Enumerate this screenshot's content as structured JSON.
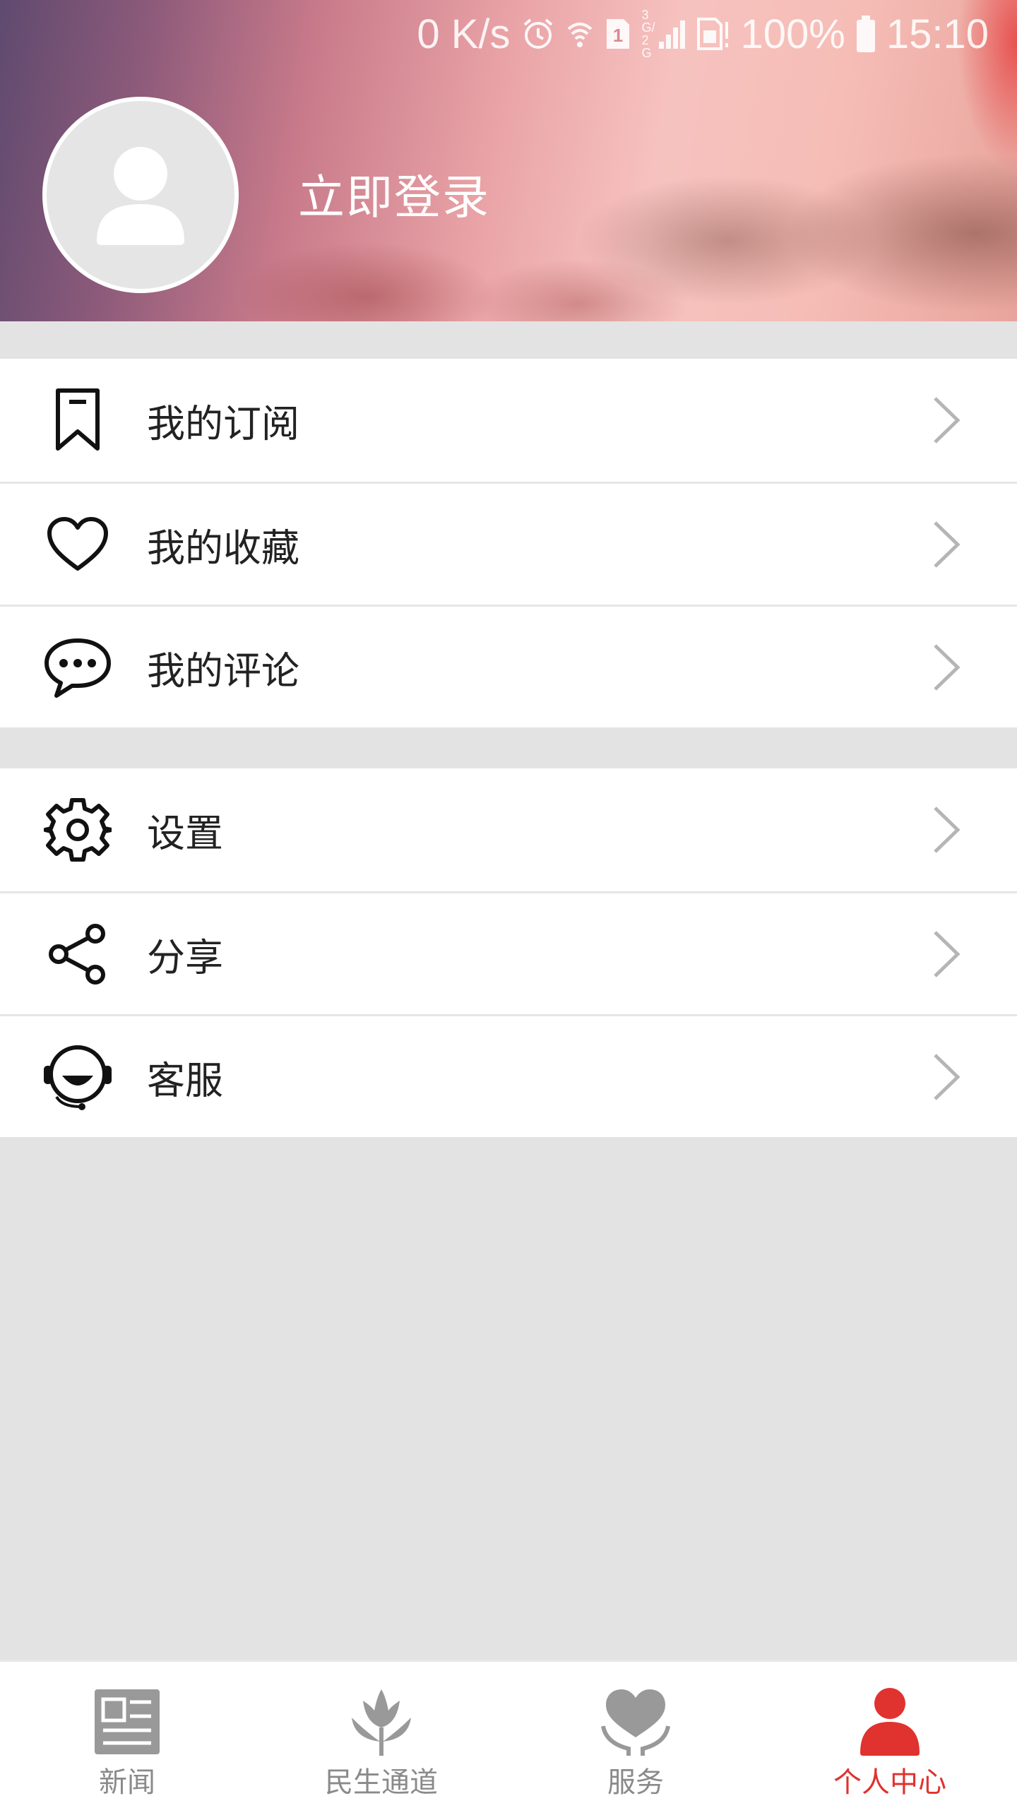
{
  "status_bar": {
    "speed": "0 K/s",
    "signal_network": "3G/2G",
    "battery": "100%",
    "time": "15:10",
    "icons": [
      "alarm-icon",
      "wifi-icon",
      "sim-1-icon",
      "signal-icon",
      "sim-card-icon",
      "battery-icon"
    ]
  },
  "profile": {
    "login_label": "立即登录",
    "avatar_icon": "user-avatar-icon"
  },
  "menu": {
    "group1": [
      {
        "label": "我的订阅",
        "icon": "bookmark-icon"
      },
      {
        "label": "我的收藏",
        "icon": "heart-icon"
      },
      {
        "label": "我的评论",
        "icon": "comment-icon"
      }
    ],
    "group2": [
      {
        "label": "设置",
        "icon": "gear-icon"
      },
      {
        "label": "分享",
        "icon": "share-icon"
      },
      {
        "label": "客服",
        "icon": "headset-icon"
      }
    ]
  },
  "tabs": [
    {
      "label": "新闻",
      "icon": "newspaper-icon",
      "active": false
    },
    {
      "label": "民生通道",
      "icon": "tulip-icon",
      "active": false
    },
    {
      "label": "服务",
      "icon": "hand-heart-icon",
      "active": false
    },
    {
      "label": "个人中心",
      "icon": "person-icon",
      "active": true
    }
  ],
  "colors": {
    "accent": "#e0322f",
    "inactive": "#8a8a8a",
    "background": "#e3e3e3"
  }
}
